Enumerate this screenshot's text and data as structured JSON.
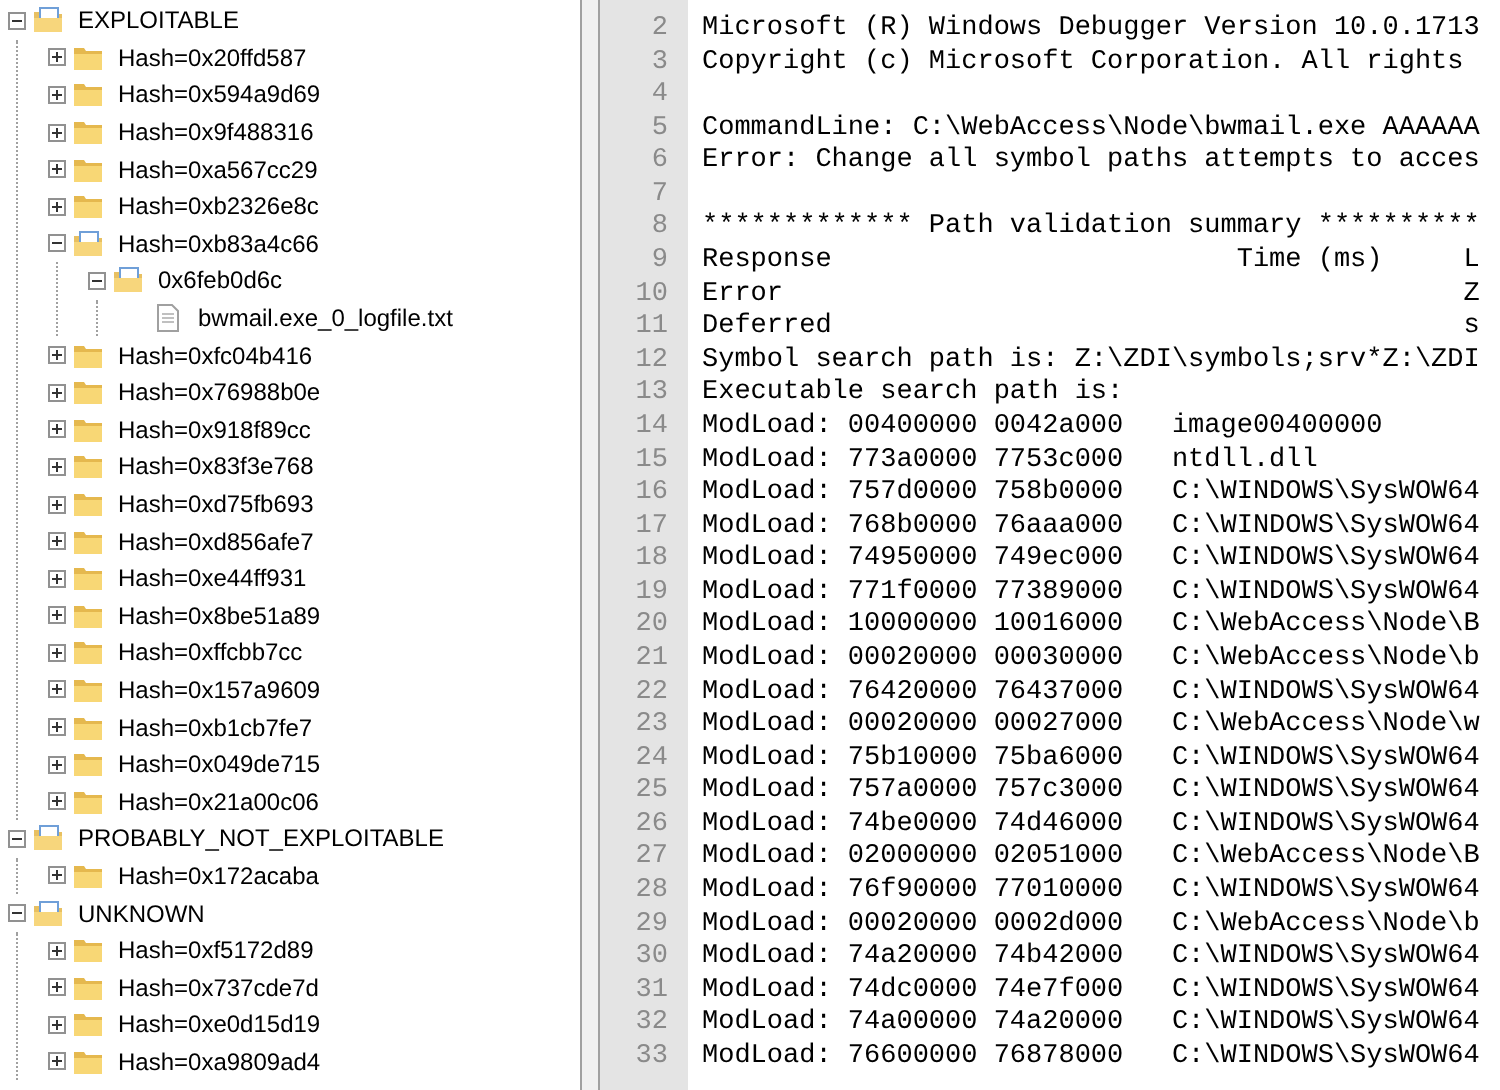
{
  "tree": [
    {
      "label": "EXPLOITABLE",
      "kind": "folder",
      "expanded": true,
      "children": [
        {
          "label": "Hash=0x20ffd587",
          "kind": "folder",
          "expanded": false
        },
        {
          "label": "Hash=0x594a9d69",
          "kind": "folder",
          "expanded": false
        },
        {
          "label": "Hash=0x9f488316",
          "kind": "folder",
          "expanded": false
        },
        {
          "label": "Hash=0xa567cc29",
          "kind": "folder",
          "expanded": false
        },
        {
          "label": "Hash=0xb2326e8c",
          "kind": "folder",
          "expanded": false
        },
        {
          "label": "Hash=0xb83a4c66",
          "kind": "folder",
          "expanded": true,
          "children": [
            {
              "label": "0x6feb0d6c",
              "kind": "folder",
              "expanded": true,
              "children": [
                {
                  "label": "bwmail.exe_0_logfile.txt",
                  "kind": "file"
                }
              ]
            }
          ]
        },
        {
          "label": "Hash=0xfc04b416",
          "kind": "folder",
          "expanded": false
        },
        {
          "label": "Hash=0x76988b0e",
          "kind": "folder",
          "expanded": false
        },
        {
          "label": "Hash=0x918f89cc",
          "kind": "folder",
          "expanded": false
        },
        {
          "label": "Hash=0x83f3e768",
          "kind": "folder",
          "expanded": false
        },
        {
          "label": "Hash=0xd75fb693",
          "kind": "folder",
          "expanded": false
        },
        {
          "label": "Hash=0xd856afe7",
          "kind": "folder",
          "expanded": false
        },
        {
          "label": "Hash=0xe44ff931",
          "kind": "folder",
          "expanded": false
        },
        {
          "label": "Hash=0x8be51a89",
          "kind": "folder",
          "expanded": false
        },
        {
          "label": "Hash=0xffcbb7cc",
          "kind": "folder",
          "expanded": false
        },
        {
          "label": "Hash=0x157a9609",
          "kind": "folder",
          "expanded": false
        },
        {
          "label": "Hash=0xb1cb7fe7",
          "kind": "folder",
          "expanded": false
        },
        {
          "label": "Hash=0x049de715",
          "kind": "folder",
          "expanded": false
        },
        {
          "label": "Hash=0x21a00c06",
          "kind": "folder",
          "expanded": false
        }
      ]
    },
    {
      "label": "PROBABLY_NOT_EXPLOITABLE",
      "kind": "folder",
      "expanded": true,
      "children": [
        {
          "label": "Hash=0x172acaba",
          "kind": "folder",
          "expanded": false
        }
      ]
    },
    {
      "label": "UNKNOWN",
      "kind": "folder",
      "expanded": true,
      "children": [
        {
          "label": "Hash=0xf5172d89",
          "kind": "folder",
          "expanded": false
        },
        {
          "label": "Hash=0x737cde7d",
          "kind": "folder",
          "expanded": false
        },
        {
          "label": "Hash=0xe0d15d19",
          "kind": "folder",
          "expanded": false
        },
        {
          "label": "Hash=0xa9809ad4",
          "kind": "folder",
          "expanded": false
        }
      ]
    }
  ],
  "editor": {
    "lines": [
      {
        "number": "2",
        "text": "Microsoft (R) Windows Debugger Version 10.0.1713"
      },
      {
        "number": "3",
        "text": "Copyright (c) Microsoft Corporation. All rights"
      },
      {
        "number": "4"
      },
      {
        "number": "5",
        "text": "CommandLine: C:\\WebAccess\\Node\\bwmail.exe AAAAAA"
      },
      {
        "number": "6",
        "text": "Error: Change all symbol paths attempts to acces"
      },
      {
        "number": "7"
      },
      {
        "number": "8",
        "text": "************* Path validation summary **********"
      },
      {
        "number": "9",
        "text": "Response                         Time (ms)     L"
      },
      {
        "number": "10",
        "text": "Error                                          Z"
      },
      {
        "number": "11",
        "text": "Deferred                                       s"
      },
      {
        "number": "12",
        "text": "Symbol search path is: Z:\\ZDI\\symbols;srv*Z:\\ZDI"
      },
      {
        "number": "13",
        "text": "Executable search path is:"
      },
      {
        "number": "14",
        "text": "ModLoad: 00400000 0042a000   image00400000"
      },
      {
        "number": "15",
        "text": "ModLoad: 773a0000 7753c000   ntdll.dll"
      },
      {
        "number": "16",
        "text": "ModLoad: 757d0000 758b0000   C:\\WINDOWS\\SysWOW64"
      },
      {
        "number": "17",
        "text": "ModLoad: 768b0000 76aaa000   C:\\WINDOWS\\SysWOW64"
      },
      {
        "number": "18",
        "text": "ModLoad: 74950000 749ec000   C:\\WINDOWS\\SysWOW64"
      },
      {
        "number": "19",
        "text": "ModLoad: 771f0000 77389000   C:\\WINDOWS\\SysWOW64"
      },
      {
        "number": "20",
        "text": "ModLoad: 10000000 10016000   C:\\WebAccess\\Node\\B"
      },
      {
        "number": "21",
        "text": "ModLoad: 00020000 00030000   C:\\WebAccess\\Node\\b"
      },
      {
        "number": "22",
        "text": "ModLoad: 76420000 76437000   C:\\WINDOWS\\SysWOW64"
      },
      {
        "number": "23",
        "text": "ModLoad: 00020000 00027000   C:\\WebAccess\\Node\\w"
      },
      {
        "number": "24",
        "text": "ModLoad: 75b10000 75ba6000   C:\\WINDOWS\\SysWOW64"
      },
      {
        "number": "25",
        "text": "ModLoad: 757a0000 757c3000   C:\\WINDOWS\\SysWOW64"
      },
      {
        "number": "26",
        "text": "ModLoad: 74be0000 74d46000   C:\\WINDOWS\\SysWOW64"
      },
      {
        "number": "27",
        "text": "ModLoad: 02000000 02051000   C:\\WebAccess\\Node\\B"
      },
      {
        "number": "28",
        "text": "ModLoad: 76f90000 77010000   C:\\WINDOWS\\SysWOW64"
      },
      {
        "number": "29",
        "text": "ModLoad: 00020000 0002d000   C:\\WebAccess\\Node\\b"
      },
      {
        "number": "30",
        "text": "ModLoad: 74a20000 74b42000   C:\\WINDOWS\\SysWOW64"
      },
      {
        "number": "31",
        "text": "ModLoad: 74dc0000 74e7f000   C:\\WINDOWS\\SysWOW64"
      },
      {
        "number": "32",
        "text": "ModLoad: 74a00000 74a20000   C:\\WINDOWS\\SysWOW64"
      },
      {
        "number": "33",
        "text": "ModLoad: 76600000 76878000   C:\\WINDOWS\\SysWOW64"
      }
    ]
  }
}
